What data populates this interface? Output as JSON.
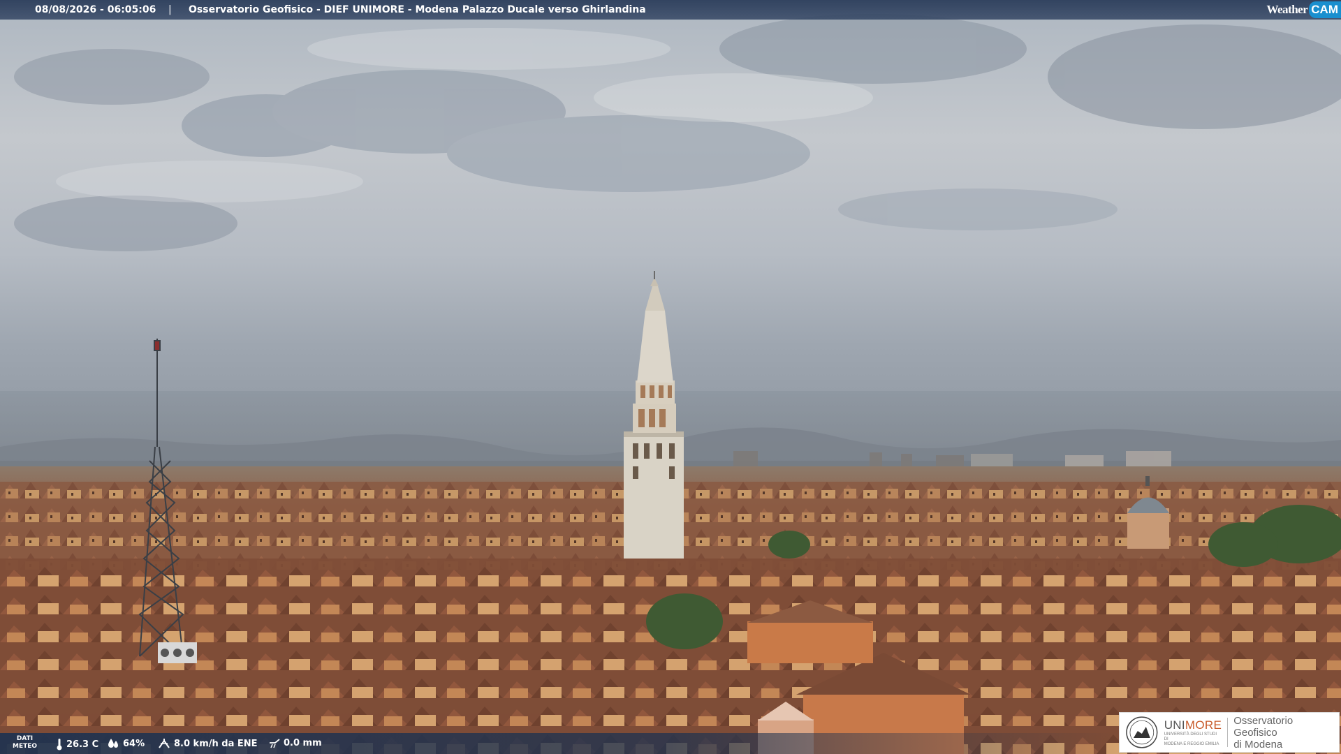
{
  "overlay": {
    "timestamp": "08/08/2026 - 06:05:06",
    "separator": "|",
    "caption": "Osservatorio Geofisico - DIEF UNIMORE - Modena Palazzo Ducale verso Ghirlandina"
  },
  "brand": {
    "weather": "Weather",
    "cam": "CAM"
  },
  "weather_data": {
    "label_line1": "DATI",
    "label_line2": "METEO",
    "temperature": "26.3 C",
    "humidity": "64%",
    "wind": "8.0 km/h da ENE",
    "rain": "0.0 mm"
  },
  "logo": {
    "uni_prefix": "UNI",
    "uni_suffix": "MORE",
    "uni_sub_line1": "UNIVERSITÀ DEGLI STUDI DI",
    "uni_sub_line2": "MODENA E REGGIO EMILIA",
    "obs_line1": "Osservatorio Geofisico",
    "obs_line2": "di Modena"
  },
  "colors": {
    "sky_top": "#b7bfc8",
    "sky_mid": "#c9ccd0",
    "roof": "#8a5a40",
    "tower": "#e2dcd0",
    "brand_blue": "#1a8fcf",
    "unimore_orange": "#c85a2a"
  },
  "icons": {
    "temperature": "thermometer-icon",
    "humidity": "droplet-icon",
    "wind": "wind-icon",
    "rain": "rain-gauge-icon"
  }
}
